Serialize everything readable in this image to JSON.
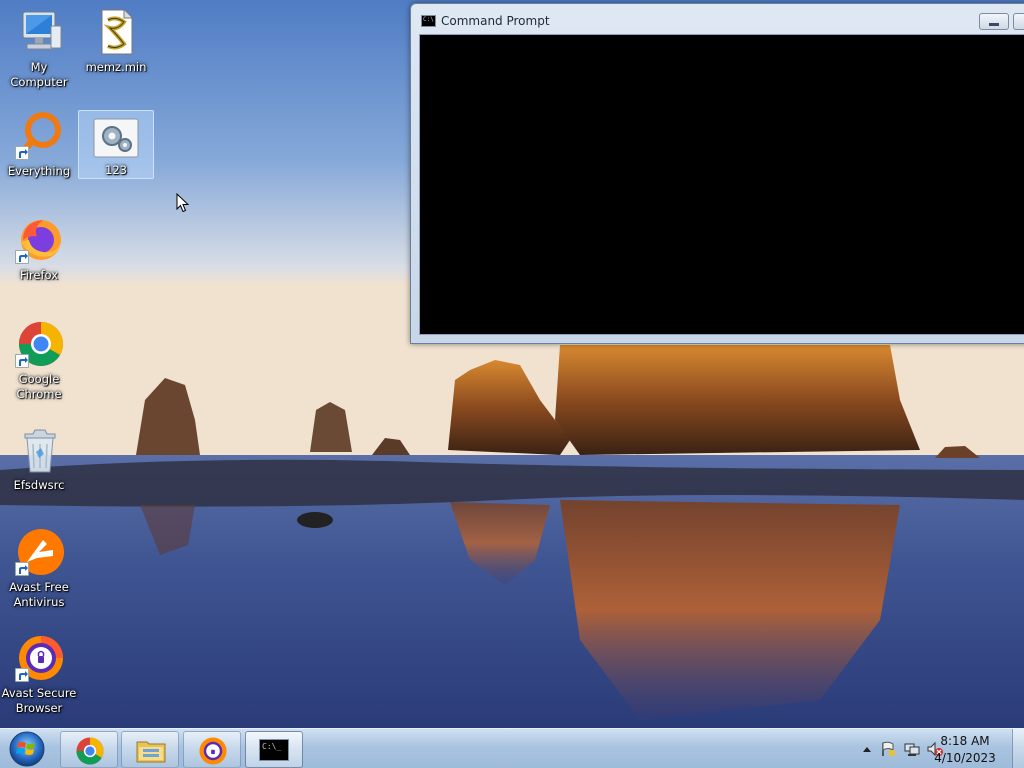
{
  "desktop": {
    "icons": [
      {
        "label": "My Computer",
        "icon": "computer-icon"
      },
      {
        "label": "memz.min",
        "icon": "script-file-icon"
      },
      {
        "label": "Everything",
        "icon": "everything-search-icon",
        "shortcut": true
      },
      {
        "label": "123",
        "icon": "settings-file-icon",
        "selected": true
      },
      {
        "label": "Firefox",
        "icon": "firefox-icon",
        "shortcut": true
      },
      {
        "label": "Google Chrome",
        "icon": "chrome-icon",
        "shortcut": true
      },
      {
        "label": "Efsdwsrc",
        "icon": "recycle-bin-icon"
      },
      {
        "label": "Avast Free Antivirus",
        "icon": "avast-antivirus-icon",
        "shortcut": true
      },
      {
        "label": "Avast Secure Browser",
        "icon": "avast-browser-icon",
        "shortcut": true
      }
    ]
  },
  "cmd_window": {
    "title": "Command Prompt",
    "icon_text": "C:\\"
  },
  "taskbar": {
    "items": [
      {
        "name": "chrome",
        "icon": "chrome-icon"
      },
      {
        "name": "file-explorer",
        "icon": "folder-icon"
      },
      {
        "name": "avast-secure-browser",
        "icon": "avast-browser-icon"
      },
      {
        "name": "command-prompt",
        "icon": "cmd-icon",
        "active": true
      }
    ],
    "cmd_icon_text": "C:\\_",
    "clock": {
      "time": "8:18 AM",
      "date": "4/10/2023"
    }
  },
  "colors": {
    "taskbar_bg": "#a9c4e0",
    "console_bg": "#000000",
    "window_frame": "#c7d6e8",
    "selection": "#c4e0ff"
  }
}
